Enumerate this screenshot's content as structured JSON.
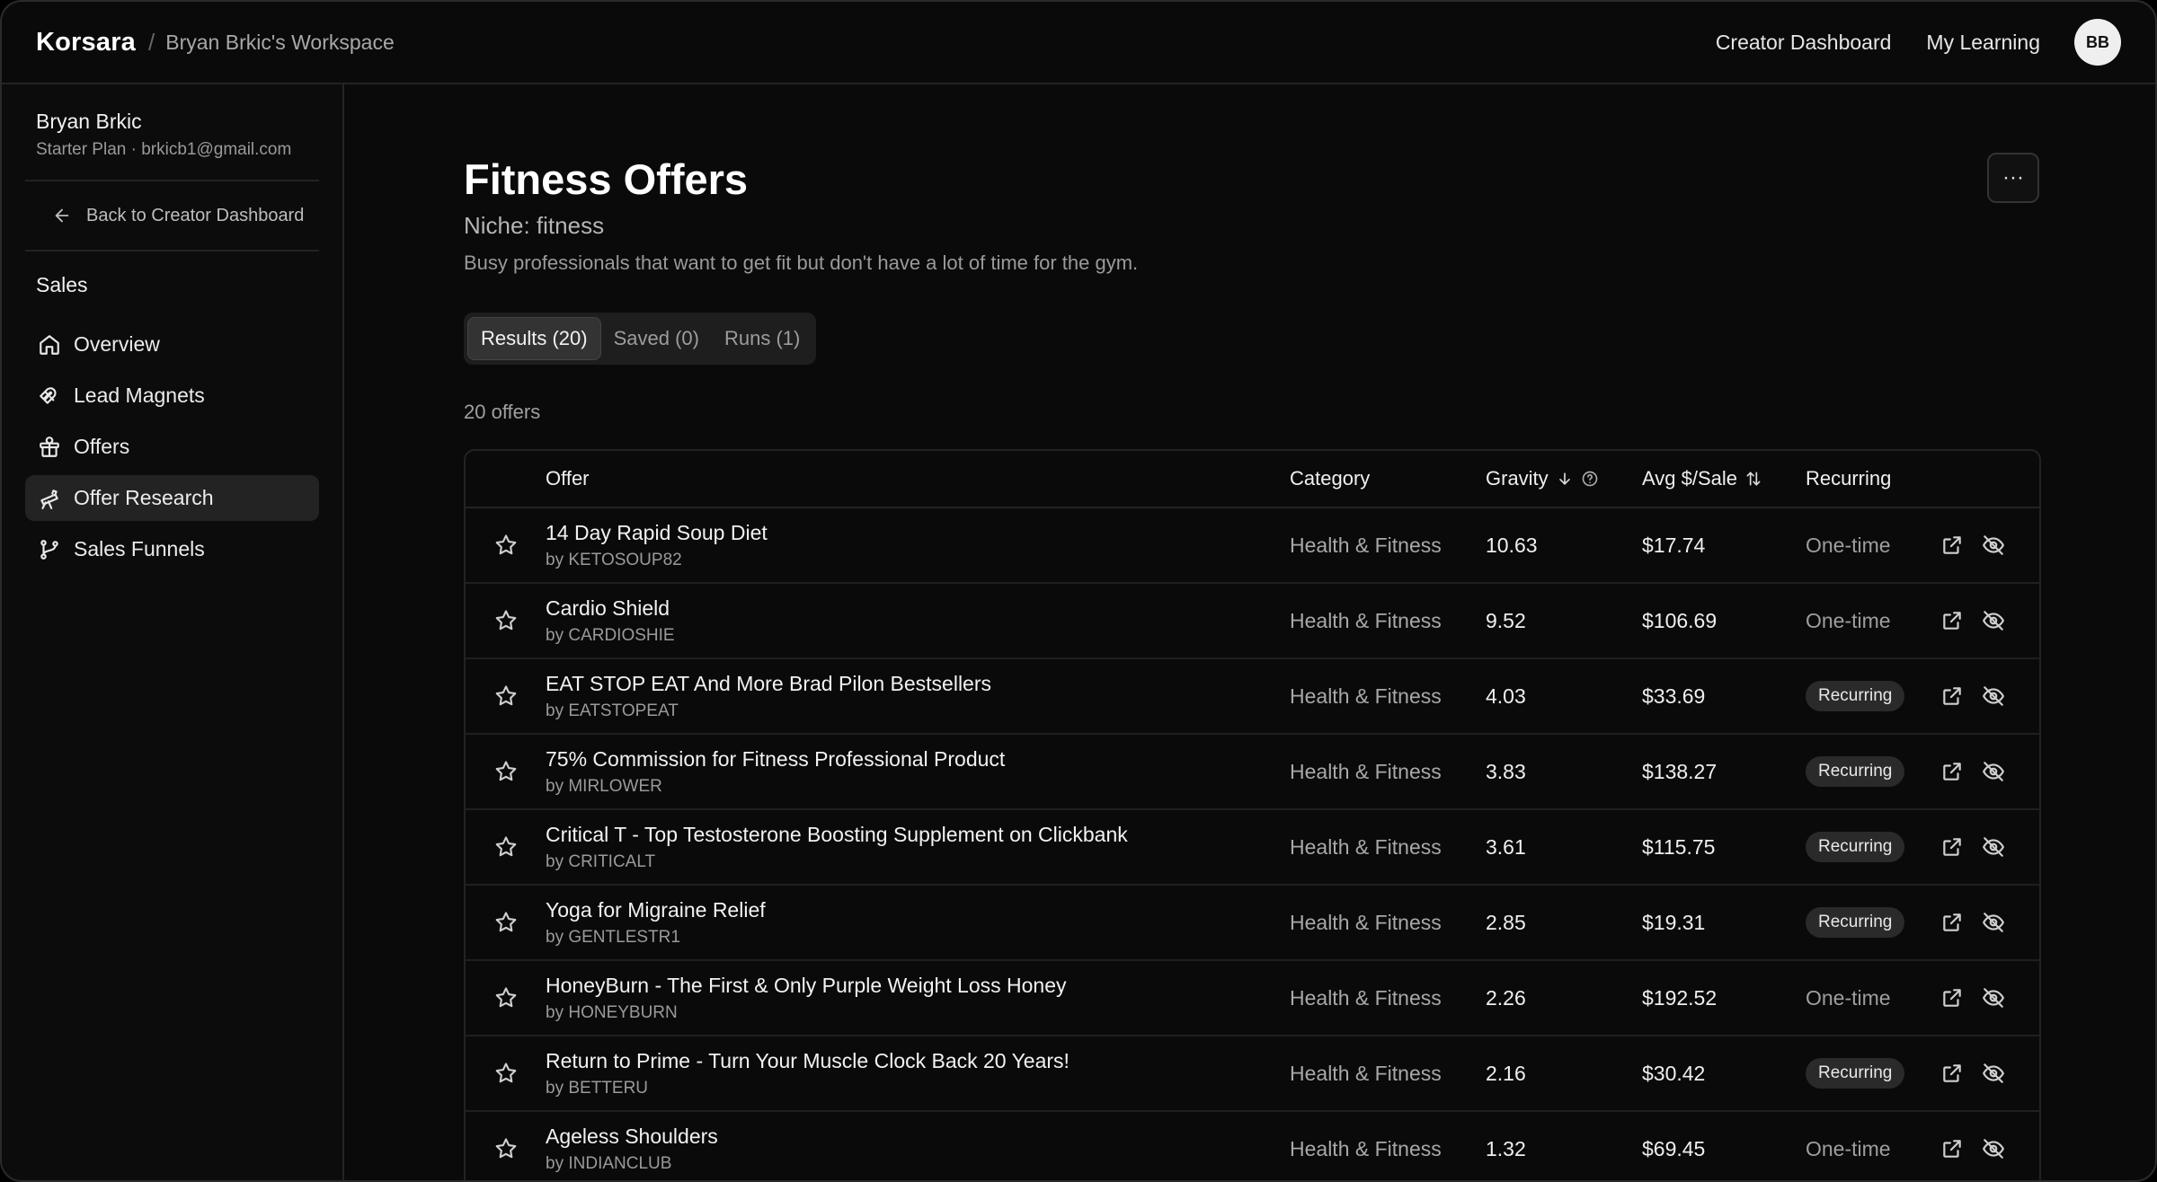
{
  "topbar": {
    "brand": "Korsara",
    "separator": "/",
    "workspace": "Bryan Brkic's Workspace",
    "nav": [
      "Creator Dashboard",
      "My Learning"
    ],
    "avatar_initials": "BB"
  },
  "sidebar": {
    "user_name": "Bryan Brkic",
    "user_plan": "Starter Plan · brkicb1@gmail.com",
    "back_label": "Back to Creator Dashboard",
    "section": "Sales",
    "items": [
      {
        "label": "Overview",
        "icon": "home-icon"
      },
      {
        "label": "Lead Magnets",
        "icon": "magnet-icon"
      },
      {
        "label": "Offers",
        "icon": "gift-icon"
      },
      {
        "label": "Offer Research",
        "icon": "telescope-icon",
        "active": true
      },
      {
        "label": "Sales Funnels",
        "icon": "funnel-branch-icon"
      }
    ]
  },
  "main": {
    "title": "Fitness Offers",
    "niche": "Niche: fitness",
    "description": "Busy professionals that want to get fit but don't have a lot of time for the gym.",
    "more_label": "···",
    "tabs": [
      "Results (20)",
      "Saved (0)",
      "Runs (1)"
    ],
    "count": "20 offers",
    "columns": [
      "Offer",
      "Category",
      "Gravity",
      "Avg $/Sale",
      "Recurring"
    ],
    "rows": [
      {
        "name": "14 Day Rapid Soup Diet",
        "by": "by KETOSOUP82",
        "category": "Health & Fitness",
        "gravity": "10.63",
        "avg": "$17.74",
        "recurring": "One-time"
      },
      {
        "name": "Cardio Shield",
        "by": "by CARDIOSHIE",
        "category": "Health & Fitness",
        "gravity": "9.52",
        "avg": "$106.69",
        "recurring": "One-time"
      },
      {
        "name": "EAT STOP EAT And More Brad Pilon Bestsellers",
        "by": "by EATSTOPEAT",
        "category": "Health & Fitness",
        "gravity": "4.03",
        "avg": "$33.69",
        "recurring": "Recurring"
      },
      {
        "name": "75% Commission for Fitness Professional Product",
        "by": "by MIRLOWER",
        "category": "Health & Fitness",
        "gravity": "3.83",
        "avg": "$138.27",
        "recurring": "Recurring"
      },
      {
        "name": "Critical T - Top Testosterone Boosting Supplement on Clickbank",
        "by": "by CRITICALT",
        "category": "Health & Fitness",
        "gravity": "3.61",
        "avg": "$115.75",
        "recurring": "Recurring"
      },
      {
        "name": "Yoga for Migraine Relief",
        "by": "by GENTLESTR1",
        "category": "Health & Fitness",
        "gravity": "2.85",
        "avg": "$19.31",
        "recurring": "Recurring"
      },
      {
        "name": "HoneyBurn - The First & Only Purple Weight Loss Honey",
        "by": "by HONEYBURN",
        "category": "Health & Fitness",
        "gravity": "2.26",
        "avg": "$192.52",
        "recurring": "One-time"
      },
      {
        "name": "Return to Prime - Turn Your Muscle Clock Back 20 Years!",
        "by": "by BETTERU",
        "category": "Health & Fitness",
        "gravity": "2.16",
        "avg": "$30.42",
        "recurring": "Recurring"
      },
      {
        "name": "Ageless Shoulders",
        "by": "by INDIANCLUB",
        "category": "Health & Fitness",
        "gravity": "1.32",
        "avg": "$69.45",
        "recurring": "One-time"
      }
    ]
  }
}
